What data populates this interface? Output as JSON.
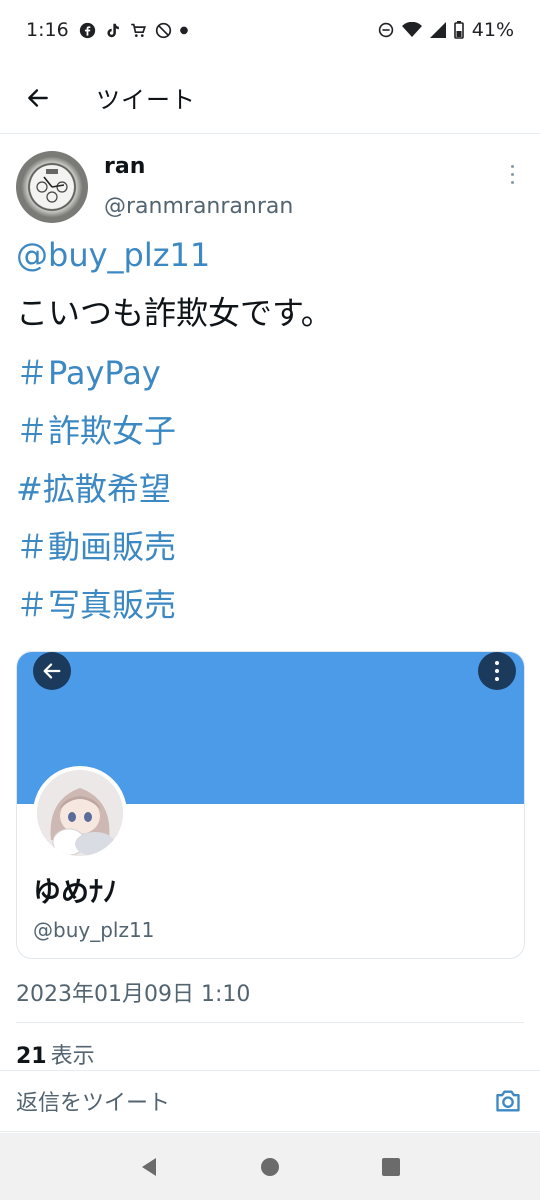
{
  "status_bar": {
    "time": "1:16",
    "battery": "41%",
    "left_icons": [
      "facebook-icon",
      "tiktok-icon",
      "cart-icon",
      "no-entry-icon"
    ],
    "right_icons": [
      "dnd-icon",
      "wifi-icon",
      "signal-icon",
      "battery-icon"
    ]
  },
  "header": {
    "title": "ツイート"
  },
  "tweet": {
    "author_name": "ran",
    "author_handle": "@ranmranranran",
    "mention": "@buy_plz11",
    "text": "こいつも詐欺女です。",
    "hashtags": [
      "＃PayPay",
      "＃詐欺女子",
      "#拡散希望",
      "＃動画販売",
      "＃写真販売"
    ],
    "timestamp": "2023年01月09日 1:10",
    "views_count": "21",
    "views_label": "表示"
  },
  "card": {
    "name": "ゆめﾅﾉ",
    "handle": "@buy_plz11"
  },
  "reply": {
    "placeholder": "返信をツイート"
  },
  "colors": {
    "link": "#3b88c3",
    "banner": "#4b9be8",
    "secondary_text": "#536471"
  }
}
